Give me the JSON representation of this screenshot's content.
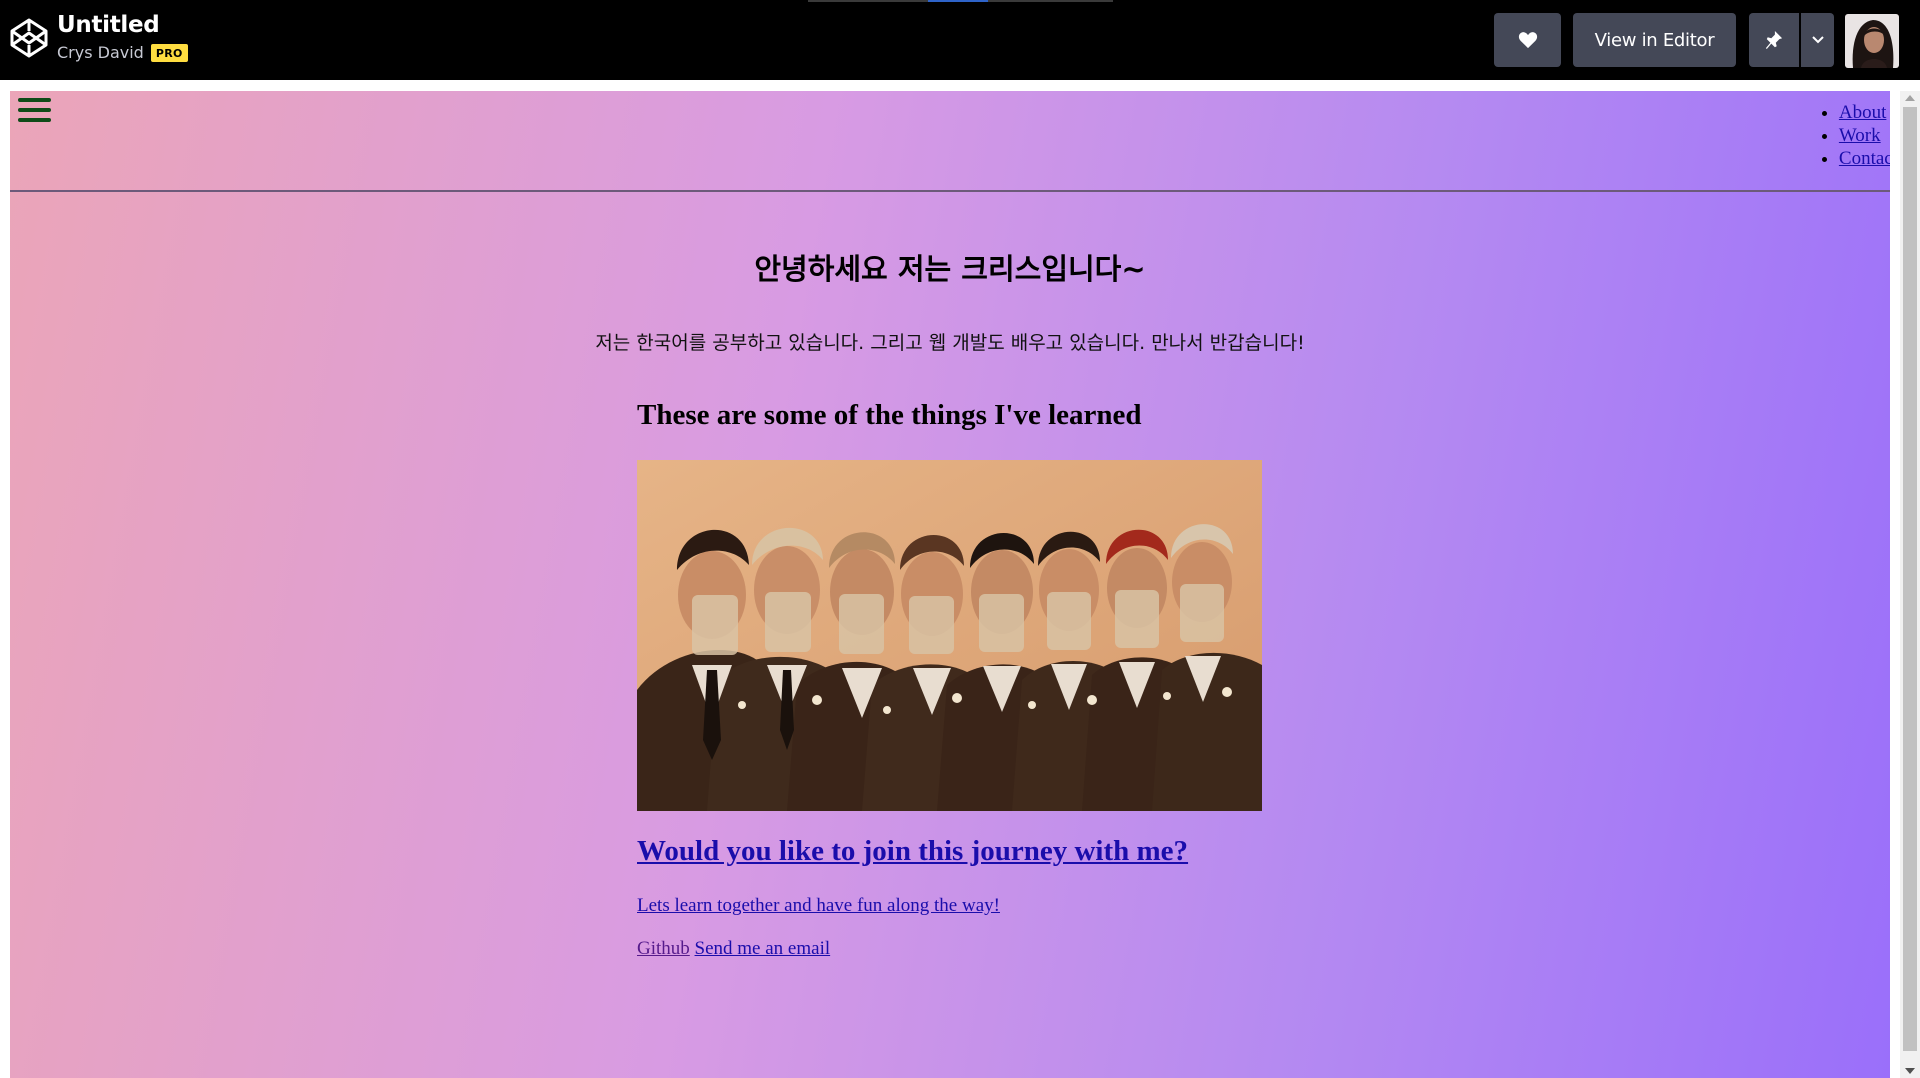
{
  "codepen": {
    "title": "Untitled",
    "author": "Crys David",
    "badge": "PRO",
    "view_in_editor_label": "View in Editor",
    "icons": [
      "codepen-logo-icon",
      "heart-icon",
      "pin-icon",
      "chevron-down-icon"
    ]
  },
  "site": {
    "nav": [
      "About",
      "Work",
      "Contact"
    ],
    "heading": "안녕하세요 저는 크리스입니다~",
    "intro": "저는 한국어를 공부하고 있습니다. 그리고 웹 개발도 배우고 있습니다. 만나서 반갑습니다!",
    "learned_heading": "These are some of the things I've learned",
    "join_link": "Would you like to join this journey with me?",
    "learn_link": "Lets learn together and have fun along the way!",
    "github_link": "Github",
    "email_link": "Send me an email"
  },
  "colors": {
    "topbar": "#000000",
    "button": "#444857",
    "badge": "#ffdd40",
    "gradient_start": "#eba5b8",
    "gradient_end": "#9a6ffa",
    "hamburger": "#0e4b18",
    "link": "#1a0dab",
    "visited_link": "#551a8b"
  }
}
